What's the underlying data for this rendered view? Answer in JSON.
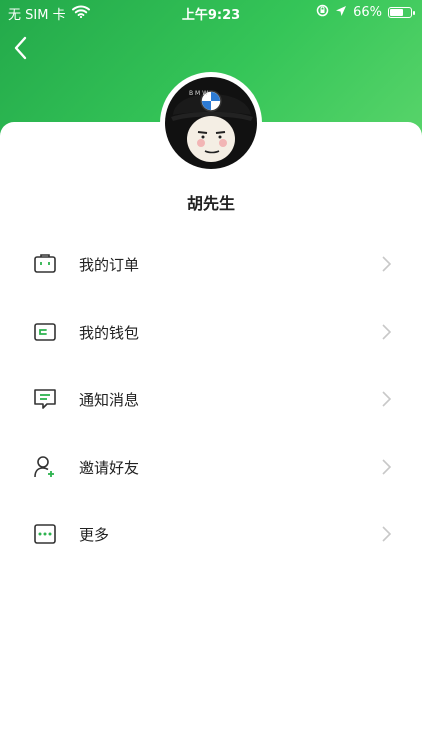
{
  "status_bar": {
    "carrier": "无 SIM 卡",
    "time": "上午9:23",
    "battery_percent": "66%",
    "battery_level": 0.66,
    "icons": [
      "wifi-icon",
      "lock-rotation-icon",
      "location-arrow-icon",
      "battery-icon"
    ]
  },
  "header": {
    "back_icon": "chevron-left-icon",
    "accent_color": "#2db34f"
  },
  "profile": {
    "avatar_icon": "avatar-meme-cap",
    "cap_text": "B M W",
    "name": "胡先生"
  },
  "menu": {
    "items": [
      {
        "label": "我的订单",
        "icon": "briefcase-icon"
      },
      {
        "label": "我的钱包",
        "icon": "wallet-icon"
      },
      {
        "label": "通知消息",
        "icon": "message-icon"
      },
      {
        "label": "邀请好友",
        "icon": "add-user-icon"
      },
      {
        "label": "更多",
        "icon": "more-dots-icon"
      }
    ]
  }
}
